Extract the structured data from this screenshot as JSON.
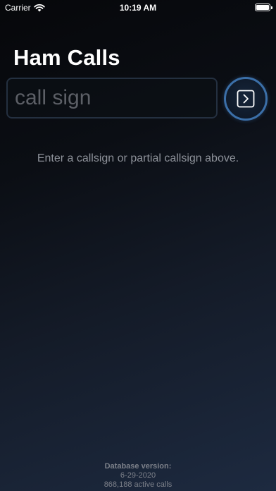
{
  "status_bar": {
    "carrier": "Carrier",
    "time": "10:19 AM",
    "battery_level": 1.0
  },
  "app": {
    "title": "Ham Calls"
  },
  "search": {
    "placeholder": "call sign",
    "value": ""
  },
  "go_button": {
    "icon": "chevron-right-square-icon"
  },
  "hint": {
    "text": "Enter a callsign or partial callsign above."
  },
  "footer": {
    "label": "Database version:",
    "date": "6-29-2020",
    "count": "868,188 active calls"
  },
  "colors": {
    "accent_ring": "#3b6fa8",
    "background_top": "#06070a",
    "background_bottom": "#1d2a40"
  }
}
